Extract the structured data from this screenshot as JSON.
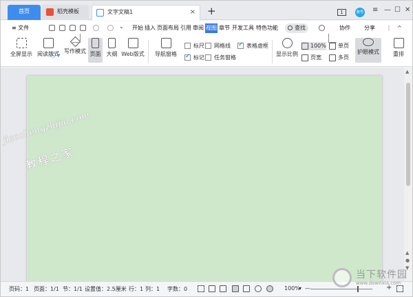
{
  "tabs": {
    "home": "首页",
    "template": "稻壳模板",
    "doc": "文字文稿1",
    "add": "+",
    "close": "×"
  },
  "window": {
    "pages_badge": "1",
    "avatar_text": "账号",
    "menu_icon": "≡",
    "min": "—",
    "max": "☐",
    "close": "✕"
  },
  "menubar": {
    "file": "≡ 文件",
    "items": [
      "开始",
      "插入",
      "页面布局",
      "引用",
      "审阅",
      "视图",
      "章节",
      "开发工具",
      "特色功能"
    ],
    "active_index": 5,
    "search": "查找",
    "collab": "协作",
    "share": "分享",
    "more": "⋮",
    "collapse": "^"
  },
  "ribbon": {
    "fullscreen": "全屏显示",
    "reading": "阅读版式",
    "writing": "写作模式",
    "page": "页面",
    "outline": "大纲",
    "web": "Web版式",
    "nav": "导航窗格",
    "checks": [
      {
        "label": "标尺",
        "checked": false
      },
      {
        "label": "网格线",
        "checked": false
      },
      {
        "label": "表格虚框",
        "checked": true
      },
      {
        "label": "标记",
        "checked": true
      },
      {
        "label": "任务窗格",
        "checked": false
      }
    ],
    "zoom_ratio": "显示比例",
    "zoom_100": "100%",
    "single_page": "单页",
    "page_width": "页宽",
    "multi_page": "多页",
    "eye_mode": "护眼模式",
    "rearrange": "重排"
  },
  "watermark": {
    "line1": "jiaochengzhijia.com",
    "line2": "教程之家"
  },
  "status": {
    "page_no": "页码：1",
    "pages": "页面：1/1",
    "section": "节：1/1",
    "setting": "设置值：2.5厘米",
    "row": "行：1",
    "col": "列：1",
    "words": "字数：0",
    "zoom": "100%",
    "zoom_minus": "—",
    "zoom_plus": "+"
  },
  "logo": {
    "name": "当下软件园",
    "url": "www.downxia.com"
  },
  "colors": {
    "page_bg": "#cfe8cc",
    "accent": "#3f8cf0",
    "active_menu": "#3a7ae0"
  }
}
